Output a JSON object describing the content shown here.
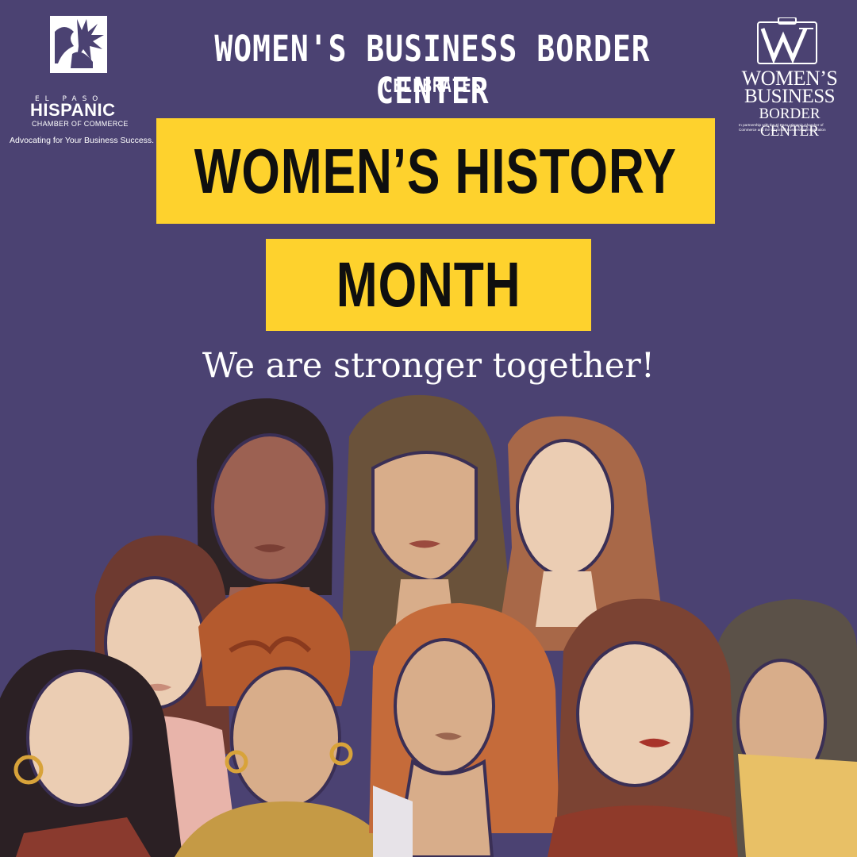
{
  "left_logo": {
    "city": "EL PASO",
    "name": "HISPANIC",
    "org": "CHAMBER OF COMMERCE",
    "slogan": "Advocating for Your Business Success."
  },
  "header": {
    "title": "WOMEN'S BUSINESS BORDER CENTER",
    "subtitle": "CELEBRATES"
  },
  "banner": {
    "line1": "WOMEN’S HISTORY",
    "line2": "MONTH",
    "color": "#fed22d"
  },
  "tagline": "We are stronger together!",
  "right_logo": {
    "line1": "WOMEN’S",
    "line2": "BUSINESS",
    "line3": "BORDER CENTER",
    "fine_print": "In partnership with the El Paso Hispanic Chamber of Commerce and the US Small Business Administration"
  },
  "colors": {
    "background": "#4b4272",
    "accent": "#fed22d",
    "text": "#ffffff"
  },
  "illustration": {
    "subject": "group-of-women-illustration"
  }
}
